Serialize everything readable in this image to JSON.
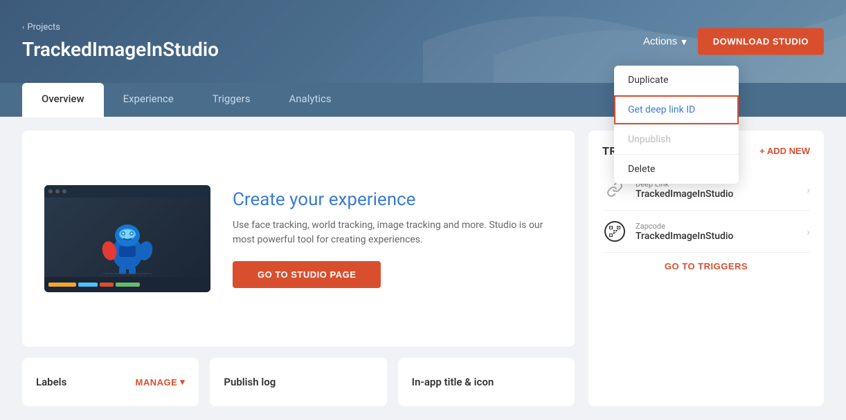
{
  "breadcrumb": {
    "arrow": "‹",
    "label": "Projects"
  },
  "header": {
    "title": "TrackedImageInStudio",
    "actions_label": "Actions",
    "download_label": "DOWNLOAD STUDIO"
  },
  "tabs": [
    {
      "id": "overview",
      "label": "Overview",
      "active": true
    },
    {
      "id": "experience",
      "label": "Experience",
      "active": false
    },
    {
      "id": "triggers",
      "label": "Triggers",
      "active": false
    },
    {
      "id": "analytics",
      "label": "Analytics",
      "active": false
    }
  ],
  "hero": {
    "title": "Create your experience",
    "description": "Use face tracking, world tracking, image tracking and more.\nStudio is our most powerful tool for creating experiences.",
    "cta_label": "GO TO STUDIO PAGE"
  },
  "triggers_panel": {
    "title": "Triggers",
    "add_new_label": "+ ADD NEW",
    "items": [
      {
        "type": "Deep Link",
        "name": "TrackedImageInStudio"
      },
      {
        "type": "Zapcode",
        "name": "TrackedImageInStudio"
      }
    ],
    "go_triggers_label": "GO TO TRIGGERS"
  },
  "bottom_cards": [
    {
      "title": "Labels",
      "action_label": "MANAGE"
    },
    {
      "title": "Publish log"
    },
    {
      "title": "In-app title & icon"
    }
  ],
  "dropdown": {
    "items": [
      {
        "label": "Duplicate",
        "highlighted": false,
        "disabled": false
      },
      {
        "label": "Get deep link ID",
        "highlighted": true,
        "disabled": false
      },
      {
        "label": "Unpublish",
        "highlighted": false,
        "disabled": true
      },
      {
        "label": "Delete",
        "highlighted": false,
        "disabled": false
      }
    ]
  },
  "colors": {
    "accent": "#d94f2e",
    "link": "#3a7bd5",
    "header_bg": "#4a6d8c"
  }
}
